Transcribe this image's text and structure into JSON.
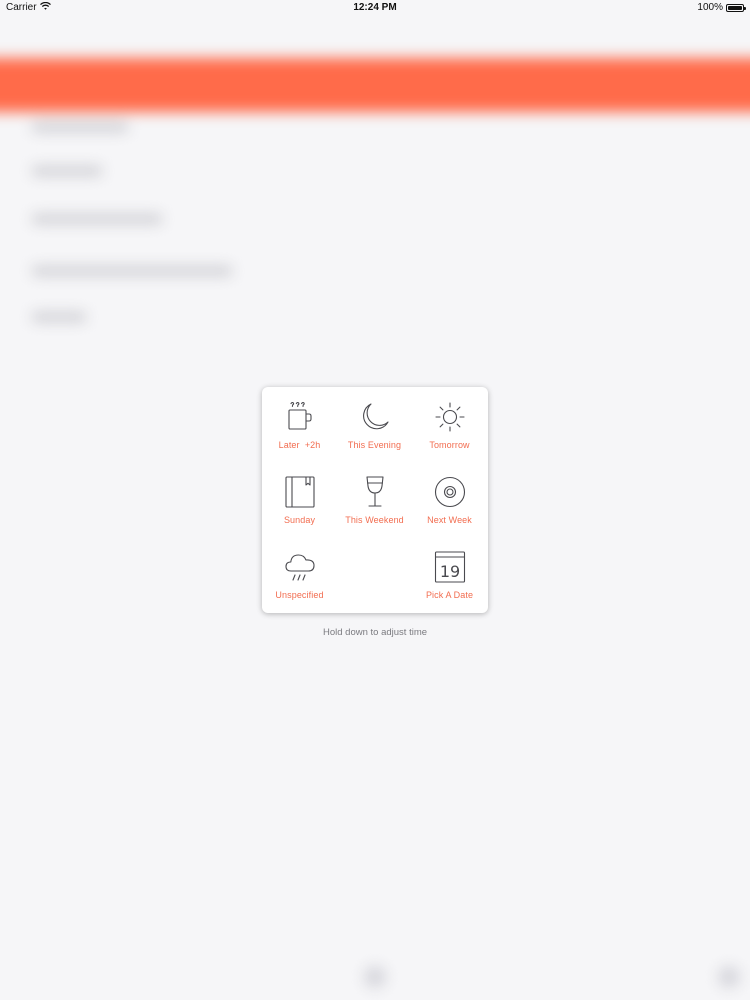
{
  "status_bar": {
    "carrier": "Carrier",
    "time": "12:24 PM",
    "battery": "100%",
    "battery_level": 1.0
  },
  "colors": {
    "accent": "#f26d50",
    "header_blurred": "#ff6b4a",
    "icon_stroke": "#4a4a4f",
    "hint_text": "#7b7b80"
  },
  "scheduler": {
    "options": [
      {
        "label": "Later  +2h",
        "icon": "coffee-cup-icon"
      },
      {
        "label": "This Evening",
        "icon": "moon-icon"
      },
      {
        "label": "Tomorrow",
        "icon": "sun-icon"
      },
      {
        "label": "Sunday",
        "icon": "book-icon"
      },
      {
        "label": "This Weekend",
        "icon": "wine-glass-icon"
      },
      {
        "label": "Next Week",
        "icon": "disc-icon"
      },
      {
        "label": "Unspecified",
        "icon": "rain-cloud-icon"
      },
      {
        "label": "Pick A Date",
        "icon": "calendar-icon"
      }
    ],
    "calendar_day": "19",
    "hint": "Hold down to adjust time"
  }
}
